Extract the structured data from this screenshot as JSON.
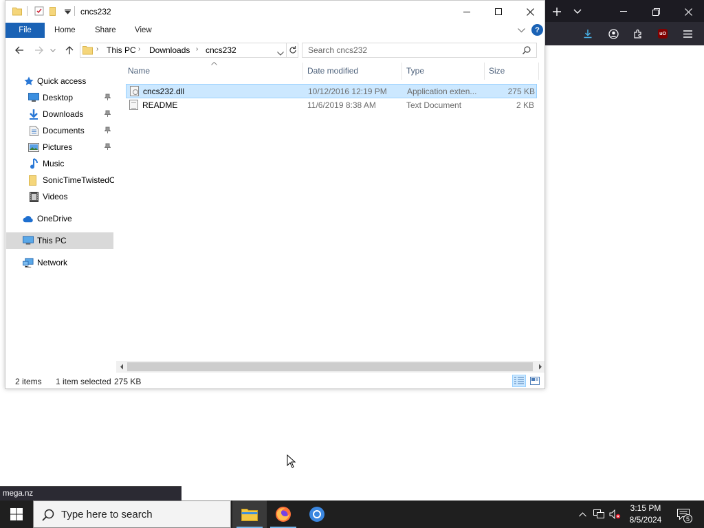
{
  "explorer": {
    "title": "cncs232",
    "ribbon_tabs": [
      "File",
      "Home",
      "Share",
      "View"
    ],
    "help": "?",
    "breadcrumb": [
      "This PC",
      "Downloads",
      "cncs232"
    ],
    "search_placeholder": "Search cncs232",
    "nav": {
      "quick_access": "Quick access",
      "items": [
        {
          "label": "Desktop",
          "icon": "desktop-icon",
          "pinned": true
        },
        {
          "label": "Downloads",
          "icon": "downloads-icon",
          "pinned": true
        },
        {
          "label": "Documents",
          "icon": "documents-icon",
          "pinned": true
        },
        {
          "label": "Pictures",
          "icon": "pictures-icon",
          "pinned": true
        },
        {
          "label": "Music",
          "icon": "music-icon",
          "pinned": false
        },
        {
          "label": "SonicTimeTwistedC",
          "icon": "folder-icon",
          "pinned": false
        },
        {
          "label": "Videos",
          "icon": "videos-icon",
          "pinned": false
        }
      ],
      "onedrive": "OneDrive",
      "this_pc": "This PC",
      "network": "Network"
    },
    "columns": [
      "Name",
      "Date modified",
      "Type",
      "Size"
    ],
    "files": [
      {
        "name": "cncs232.dll",
        "date": "10/12/2016 12:19 PM",
        "type": "Application exten...",
        "size": "275 KB",
        "selected": true
      },
      {
        "name": "README",
        "date": "11/6/2019 8:38 AM",
        "type": "Text Document",
        "size": "2 KB",
        "selected": false
      }
    ],
    "status": {
      "items": "2 items",
      "selected": "1 item selected",
      "size": "275 KB"
    }
  },
  "browser": {
    "link_hover": "mega.nz"
  },
  "taskbar": {
    "search_placeholder": "Type here to search",
    "time": "3:15 PM",
    "date": "8/5/2024",
    "notifications": "5"
  },
  "colors": {
    "accent": "#1a62b5",
    "selection": "#cce8ff",
    "taskbar": "#1f1f1f",
    "browser_dark": "#2b2a33"
  }
}
